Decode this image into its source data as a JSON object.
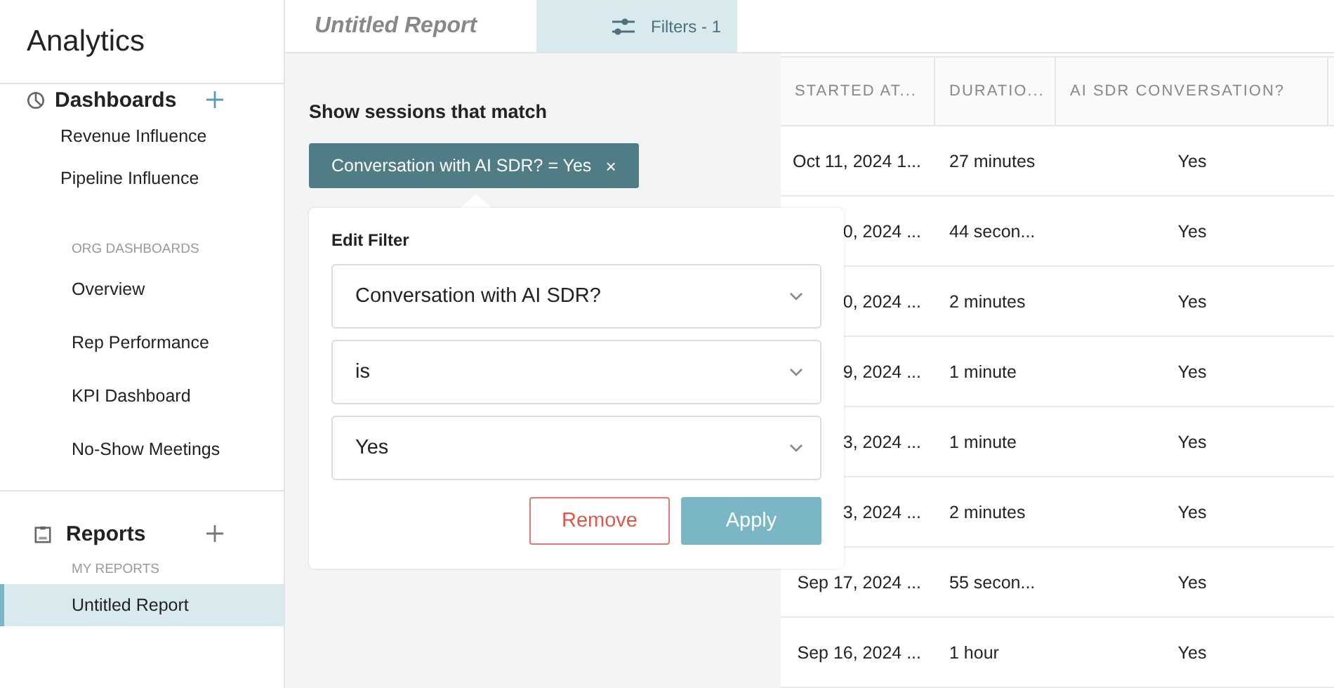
{
  "app": {
    "title": "Analytics"
  },
  "sidebar": {
    "sections": [
      {
        "kind": "dashboards",
        "title": "Dashboards",
        "items": [
          {
            "label": "Revenue Influence",
            "selected": false
          },
          {
            "label": "Pipeline Influence",
            "selected": false
          }
        ],
        "subheading": "ORG DASHBOARDS",
        "subitems": [
          {
            "label": "Overview",
            "selected": false
          },
          {
            "label": "Rep Performance",
            "selected": false
          },
          {
            "label": "KPI Dashboard",
            "selected": false
          },
          {
            "label": "No-Show Meetings",
            "selected": false
          }
        ]
      },
      {
        "kind": "reports",
        "title": "Reports",
        "subheading": "MY REPORTS",
        "subitems": [
          {
            "label": "Untitled Report",
            "selected": true
          }
        ]
      }
    ]
  },
  "report": {
    "title": "Untitled Report"
  },
  "filters_tab": {
    "label": "Filters - 1",
    "selected": true
  },
  "filter_panel": {
    "heading": "Show sessions that match",
    "chips": [
      {
        "label": "Conversation with AI SDR? = Yes",
        "remove": "×"
      }
    ]
  },
  "edit_filter": {
    "title": "Edit Filter",
    "selects": [
      {
        "value": "Conversation with AI SDR?"
      },
      {
        "value": "is"
      },
      {
        "value": "Yes"
      }
    ],
    "buttons": [
      {
        "kind": "secondary",
        "label": "Remove"
      },
      {
        "kind": "primary",
        "label": "Apply"
      }
    ]
  },
  "table": {
    "columns": [
      "STARTED AT...",
      "DURATIO...",
      "AI SDR CONVERSATION?"
    ],
    "rows": [
      [
        "Oct 11, 2024 1...",
        "27 minutes",
        "Yes"
      ],
      [
        "0, 2024 ...",
        "44 secon...",
        "Yes"
      ],
      [
        "0, 2024 ...",
        "2 minutes",
        "Yes"
      ],
      [
        "9, 2024 ...",
        "1 minute",
        "Yes"
      ],
      [
        "3, 2024 ...",
        "1 minute",
        "Yes"
      ],
      [
        "3, 2024 ...",
        "2 minutes",
        "Yes"
      ],
      [
        "Sep 17, 2024 ...",
        "55 secon...",
        "Yes"
      ],
      [
        "Sep 16, 2024 ...",
        "1 hour",
        "Yes"
      ]
    ]
  }
}
